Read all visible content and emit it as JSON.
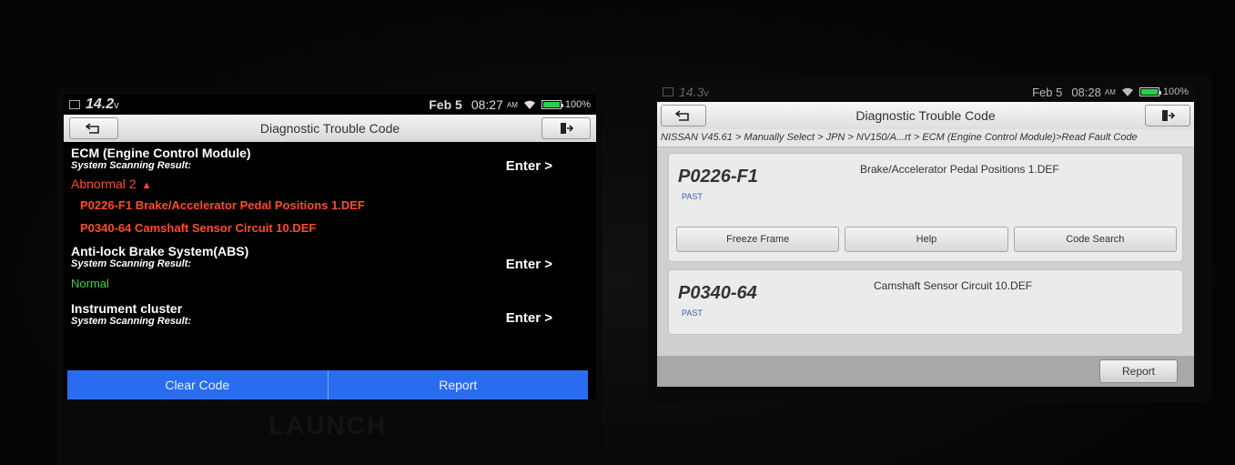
{
  "left_screen": {
    "status_bar": {
      "voltage": "14.2",
      "voltage_unit": "v",
      "date": "Feb 5",
      "time": "08:27",
      "ampm": "AM",
      "battery": "100%",
      "battery_level": 1.0
    },
    "title": "Diagnostic Trouble Code",
    "systems": [
      {
        "name": "ECM (Engine Control Module)",
        "scan_label": "System Scanning Result:",
        "enter": "Enter >",
        "status": "Abnormal 2",
        "dtcs": [
          "P0226-F1 Brake/Accelerator Pedal Positions 1.DEF",
          "P0340-64 Camshaft Sensor Circuit 10.DEF"
        ]
      },
      {
        "name": "Anti-lock Brake System(ABS)",
        "scan_label": "System Scanning Result:",
        "enter": "Enter >",
        "status": "Normal"
      },
      {
        "name": "Instrument cluster",
        "scan_label": "System Scanning Result:",
        "enter": "Enter >"
      }
    ],
    "buttons": {
      "clear_code": "Clear Code",
      "report": "Report"
    },
    "watermark": "LAUNCH"
  },
  "right_screen": {
    "status_bar": {
      "voltage": "14.3",
      "voltage_unit": "v",
      "date": "Feb 5",
      "time": "08:28",
      "ampm": "AM",
      "battery": "100%",
      "battery_level": 1.0
    },
    "title": "Diagnostic Trouble Code",
    "breadcrumb": "NISSAN V45.61 > Manually Select > JPN > NV150/A...rt > ECM (Engine Control Module)>Read Fault Code",
    "dtcs": [
      {
        "code": "P0226-F1",
        "status": "PAST",
        "description": "Brake/Accelerator Pedal Positions 1.DEF",
        "actions": [
          "Freeze Frame",
          "Help",
          "Code Search"
        ]
      },
      {
        "code": "P0340-64",
        "status": "PAST",
        "description": "Camshaft Sensor Circuit 10.DEF"
      }
    ],
    "report": "Report"
  },
  "colors": {
    "fault_red": "#ff4b2b",
    "normal_green": "#3ed13e",
    "button_blue": "#2a6cf0"
  },
  "icons": [
    "back-arrow-icon",
    "exit-icon",
    "wifi-icon",
    "battery-icon",
    "calendar-icon",
    "expand-up-icon"
  ]
}
